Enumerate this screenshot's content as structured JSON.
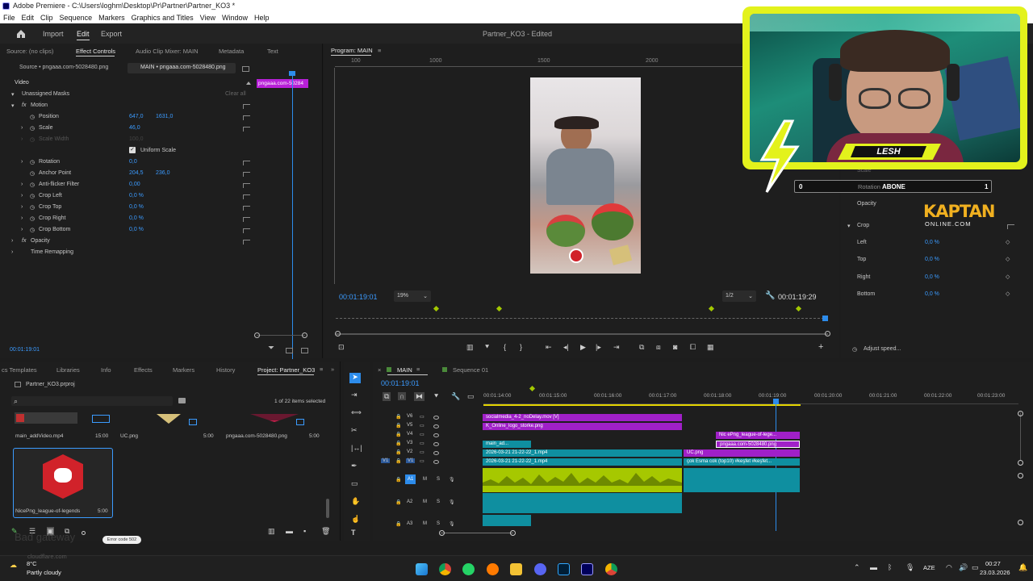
{
  "window": {
    "title": "Adobe Premiere - C:\\Users\\loghm\\Desktop\\Pr\\Partner\\Partner_KO3 *"
  },
  "menu": [
    "File",
    "Edit",
    "Clip",
    "Sequence",
    "Markers",
    "Graphics and Titles",
    "View",
    "Window",
    "Help"
  ],
  "workspace": {
    "tabs": [
      "Import",
      "Edit",
      "Export"
    ],
    "active": "Edit",
    "project_title": "Partner_KO3 - Edited"
  },
  "effect_controls": {
    "tabs": [
      "Source: (no clips)",
      "Effect Controls",
      "Audio Clip Mixer: MAIN",
      "Metadata",
      "Text"
    ],
    "source_clip": "Source • pngaaa.com-5028480.png",
    "main_clip": "MAIN • pngaaa.com-5028480.png",
    "mini_clip_label": "pngaaa.com-50284",
    "section": "Video",
    "unassigned_masks": "Unassigned Masks",
    "clear_all": "Clear all",
    "props": [
      {
        "name": "Motion",
        "v1": "",
        "v2": ""
      },
      {
        "name": "Position",
        "v1": "647,0",
        "v2": "1631,0"
      },
      {
        "name": "Scale",
        "v1": "46,0",
        "v2": ""
      },
      {
        "name": "Scale Width",
        "v1": "100,0",
        "v2": ""
      },
      {
        "name": "Uniform Scale",
        "v1": "",
        "v2": ""
      },
      {
        "name": "Rotation",
        "v1": "0,0",
        "v2": ""
      },
      {
        "name": "Anchor Point",
        "v1": "204,5",
        "v2": "236,0"
      },
      {
        "name": "Anti-flicker Filter",
        "v1": "0,00",
        "v2": ""
      },
      {
        "name": "Crop Left",
        "v1": "0,0 %",
        "v2": ""
      },
      {
        "name": "Crop Top",
        "v1": "0,0 %",
        "v2": ""
      },
      {
        "name": "Crop Right",
        "v1": "0,0 %",
        "v2": ""
      },
      {
        "name": "Crop Bottom",
        "v1": "0,0 %",
        "v2": ""
      },
      {
        "name": "Opacity",
        "v1": "",
        "v2": ""
      },
      {
        "name": "Time Remapping",
        "v1": "",
        "v2": ""
      }
    ],
    "timecode": "00:01:19:01"
  },
  "program": {
    "tab": "Program: MAIN",
    "ruler": [
      "100",
      "1000",
      "1500",
      "2000"
    ],
    "timecode": "00:01:19:01",
    "zoom": "19%",
    "resolution": "1/2",
    "duration": "00:01:19:29"
  },
  "webcam": {
    "name": "LESH"
  },
  "overlay": {
    "left": "0",
    "label": "Rotation",
    "abone": "ABONE",
    "right": "1",
    "brand1": "KAPTAN",
    "brand2": "ONLINE.COM"
  },
  "right_panel": {
    "rows": [
      "Opacity",
      "Crop",
      "Left",
      "Top",
      "Right",
      "Bottom"
    ],
    "values": [
      "0,0 %",
      "0,0 %",
      "0,0 %",
      "0,0 %"
    ],
    "scale_label": "Scale",
    "adjust_speed": "Adjust speed..."
  },
  "project": {
    "tabs": [
      "cs Templates",
      "Libraries",
      "Info",
      "Effects",
      "Markers",
      "History",
      "Project: Partner_KO3"
    ],
    "file": "Partner_KO3.prproj",
    "selected": "1 of 22 items selected",
    "items": [
      {
        "name": "main_addVideo.mp4",
        "dur": "15:00"
      },
      {
        "name": "UC.png",
        "dur": "5:00"
      },
      {
        "name": "pngaaa.com-5028480.png",
        "dur": "5:00"
      },
      {
        "name": "NicePng_league-of-legends",
        "dur": "5:00"
      }
    ],
    "error": "Error code 502",
    "bad_gateway": "Bad gateway",
    "cloudflare": "cloudflare.com"
  },
  "timeline": {
    "tabs": [
      "MAIN",
      "Sequence 01"
    ],
    "timecode": "00:01:19:01",
    "ruler": [
      "00:01:14:00",
      "00:01:15:00",
      "00:01:16:00",
      "00:01:17:00",
      "00:01:18:00",
      "00:01:19:00",
      "00:01:20:00",
      "00:01:21:00",
      "00:01:22:00",
      "00:01:23:00"
    ],
    "tracks": [
      "V6",
      "V5",
      "V4",
      "V3",
      "V2",
      "V1",
      "A1",
      "A2",
      "A3"
    ],
    "clips": {
      "v6a": "socialmedia_4-2_noDelay.mov [V]",
      "v5a": "K_Online_logo_storke.png",
      "v4b": "Nic ePng_league-of-lege...",
      "v3a": "main_ad...",
      "v3b": "pngaaa.com-5028480.png",
      "v2a": "2026-03-21 21-22-22_1.mp4",
      "v2b": "UC.png",
      "v1a": "2026-03-21 21-22-22_1.mp4",
      "v1b": "çok Esma cok (top10) #keşfet #keşfet..."
    }
  },
  "taskbar": {
    "weather_temp": "8°C",
    "weather_desc": "Partly cloudy",
    "lang": "AZE",
    "time": "00:27",
    "date": "23.03.2026"
  },
  "colors": {
    "accent": "#2d8ceb",
    "clip_violet": "#a020c8",
    "clip_teal": "#0f8fa0",
    "clip_audio": "#a6c800",
    "webcam_frame": "#e3f21c"
  }
}
